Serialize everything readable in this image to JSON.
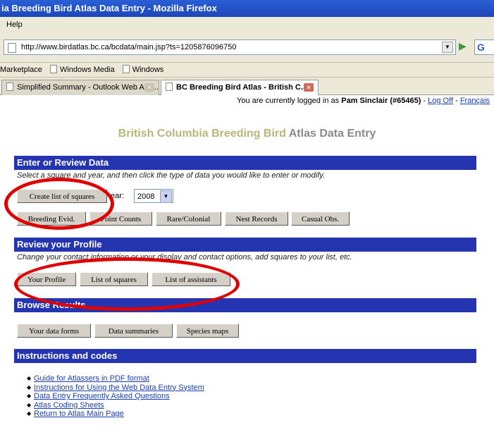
{
  "window": {
    "title": "ia Breeding Bird Atlas Data Entry - Mozilla Firefox"
  },
  "menu": {
    "help": "Help"
  },
  "nav": {
    "url": "http://www.birdatlas.bc.ca/bcdata/main.jsp?ts=1205876096750",
    "search_icon": "google-icon"
  },
  "bookmarks": [
    "Marketplace",
    "Windows Media",
    "Windows"
  ],
  "tabs": [
    {
      "label": "Simplified Summary - Outlook Web Acc..."
    },
    {
      "label": "BC Breeding Bird Atlas - British C..."
    }
  ],
  "login": {
    "prefix": "You are currently logged in as",
    "user": "Pam Sinclair (#65465)",
    "sep1": " - ",
    "logoff": "Log Off",
    "sep2": " - ",
    "francais": "Français"
  },
  "page": {
    "title_a": "British Columbia Breeding Bird ",
    "title_b": "Atlas Data Entry"
  },
  "enter": {
    "heading": "Enter or Review Data",
    "desc": "Select a square and year, and then click the type of data you would like to enter or modify.",
    "create_btn": "Create list of squares",
    "year_label": "ear:",
    "year_value": "2008",
    "buttons": [
      "Breeding Evid.",
      "Point Counts",
      "Rare/Colonial",
      "Nest Records",
      "Casual Obs."
    ]
  },
  "profile": {
    "heading": "Review your  Profile",
    "desc": "Change your contact information or your display and contact options, add squares to your list, etc.",
    "buttons": [
      "Your Profile",
      "List of squares",
      "List of assistants"
    ]
  },
  "browse": {
    "heading": "Browse  Results",
    "buttons": [
      "Your data forms",
      "Data summaries",
      "Species maps"
    ]
  },
  "instructions": {
    "heading": "Instructions and codes",
    "links": [
      "Guide for Atlassers in PDF format",
      "Instructions for Using the Web Data Entry System",
      "Data Entry Frequently Asked Questions",
      "Atlas Coding Sheets",
      "Return to Atlas Main Page"
    ]
  },
  "colors": {
    "header_bg": "#2534b0",
    "annotation": "#e00000",
    "title": "#b7b77a"
  }
}
